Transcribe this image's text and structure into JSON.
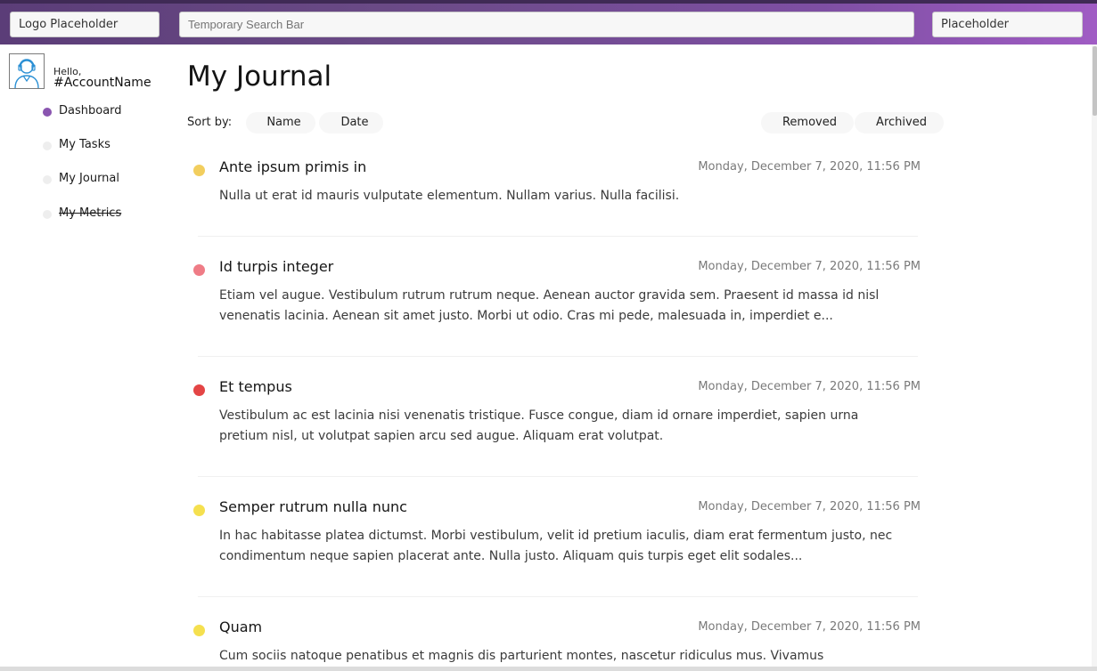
{
  "header": {
    "logo": "Logo Placeholder",
    "search_placeholder": "Temporary Search Bar",
    "right_placeholder": "Placeholder"
  },
  "user": {
    "greeting": "Hello,",
    "account": "#AccountName"
  },
  "sidebar": {
    "items": [
      {
        "label": "Dashboard",
        "active": true
      },
      {
        "label": "My Tasks",
        "active": false
      },
      {
        "label": "My Journal",
        "active": false
      },
      {
        "label": "My Metrics",
        "active": false,
        "strikethrough": true
      }
    ]
  },
  "main": {
    "title": "My Journal",
    "sort_label": "Sort by:",
    "sort_options": [
      "Name",
      "Date"
    ],
    "filter_options": [
      "Removed",
      "Archived"
    ],
    "entries": [
      {
        "title": "Ante ipsum primis in",
        "date": "Monday, December 7, 2020, 11:56 PM",
        "body": "Nulla ut erat id mauris vulputate elementum. Nullam varius. Nulla facilisi.",
        "color": "#f2ce5e"
      },
      {
        "title": "Id turpis integer",
        "date": "Monday, December 7, 2020, 11:56 PM",
        "body": "Etiam vel augue. Vestibulum rutrum rutrum neque. Aenean auctor gravida sem. Praesent id massa id nisl venenatis lacinia. Aenean sit amet justo. Morbi ut odio. Cras mi pede, malesuada in, imperdiet e...",
        "color": "#ef7c86"
      },
      {
        "title": "Et tempus",
        "date": "Monday, December 7, 2020, 11:56 PM",
        "body": "Vestibulum ac est lacinia nisi venenatis tristique. Fusce congue, diam id ornare imperdiet, sapien urna pretium nisl, ut volutpat sapien arcu sed augue. Aliquam erat volutpat.",
        "color": "#e44545"
      },
      {
        "title": "Semper rutrum nulla nunc",
        "date": "Monday, December 7, 2020, 11:56 PM",
        "body": "In hac habitasse platea dictumst. Morbi vestibulum, velit id pretium iaculis, diam erat fermentum justo, nec condimentum neque sapien placerat ante. Nulla justo. Aliquam quis turpis eget elit sodales...",
        "color": "#f5e04f"
      },
      {
        "title": "Quam",
        "date": "Monday, December 7, 2020, 11:56 PM",
        "body": "Cum sociis natoque penatibus et magnis dis parturient montes, nascetur ridiculus mus. Vivamus",
        "color": "#f5e04f"
      }
    ]
  }
}
